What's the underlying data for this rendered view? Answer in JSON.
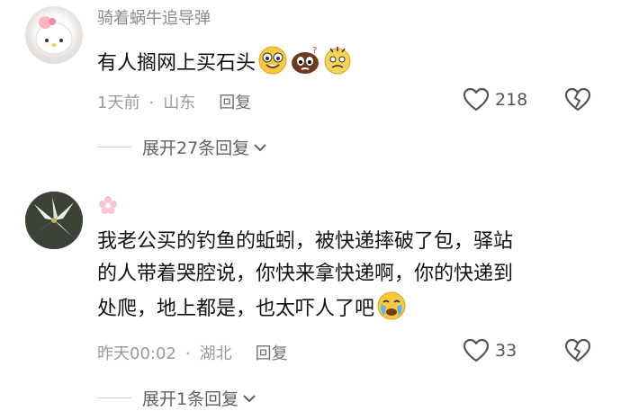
{
  "comments": [
    {
      "username": "骑着蜗牛追导弹",
      "text": "有人搁网上买石头",
      "time": "1天前",
      "location": "山东",
      "reply_label": "回复",
      "likes": "218",
      "expand_label": "展开27条回复",
      "emojis": [
        "grinning-glasses-emoji",
        "poop-question-emoji",
        "anxious-cry-emoji"
      ]
    },
    {
      "username": "",
      "text_lines": [
        "我老公买的钓鱼的蚯蚓，被快递摔破了包，驿站",
        "的人带着哭腔说，你快来拿快递啊，你的快递到",
        "处爬，地上都是，也太吓人了吧"
      ],
      "time": "昨天00:02",
      "location": "湖北",
      "reply_label": "回复",
      "likes": "33",
      "expand_label": "展开1条回复",
      "emojis": [
        "crying-emoji"
      ]
    }
  ],
  "separator": "·"
}
